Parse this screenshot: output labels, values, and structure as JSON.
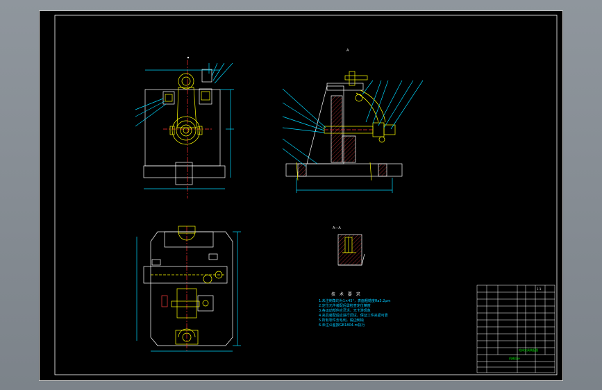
{
  "drawing": {
    "tech_requirements_title": "技 术 要 求",
    "tech_requirements": [
      "1.未注倒角均为1×45°，表面粗糙度Ra3.2μm",
      "2.定位元件装配后需检查定位精度",
      "3.各运动部件应灵活，无卡滞现象",
      "4.夹具装配后应进行调试，保证工件夹紧可靠",
      "5.所有零件去毛刺，锐边倒钝",
      "6.未注公差按GB1804-m执行"
    ],
    "view_labels": {
      "section": "A—A",
      "top_marker": "A"
    },
    "title_block": {
      "drawing_name": "钻床夹具装配图",
      "company": "机械设计",
      "scale": "1:1"
    },
    "colors": {
      "background": "#000000",
      "outline": "#ffffff",
      "dimension": "#00d8ff",
      "part": "#ffff00",
      "hatch": "#ff4040",
      "centerline": "#ff3030",
      "text_green": "#00e000"
    }
  }
}
